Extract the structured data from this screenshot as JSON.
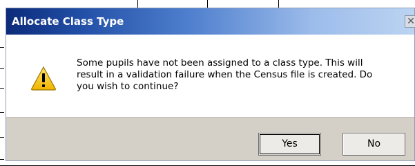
{
  "dialog": {
    "title": "Allocate Class Type",
    "close_glyph": "✕",
    "icon": "warning-icon",
    "message": "Some pupils have not been assigned to a class type. This will result in a validation failure when the Census file is created.  Do you wish to continue?",
    "buttons": {
      "yes_label": "Yes",
      "no_label": "No"
    }
  },
  "colors": {
    "titlebar_start": "#0c2a7a",
    "titlebar_end": "#bcd4f2",
    "footer_bg": "#d4d0c8",
    "warning_fill": "#f4c521"
  }
}
